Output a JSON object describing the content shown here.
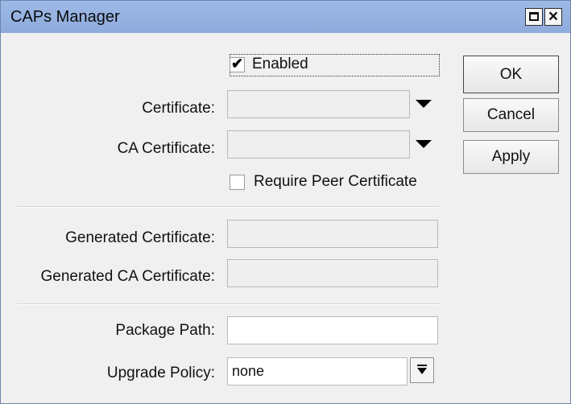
{
  "window": {
    "title": "CAPs Manager"
  },
  "enabled": {
    "label": "Enabled",
    "checked": true
  },
  "certificate": {
    "label": "Certificate:",
    "value": ""
  },
  "ca_certificate": {
    "label": "CA Certificate:",
    "value": ""
  },
  "require_peer": {
    "label": "Require Peer Certificate",
    "checked": false
  },
  "generated_certificate": {
    "label": "Generated Certificate:",
    "value": ""
  },
  "generated_ca_certificate": {
    "label": "Generated CA Certificate:",
    "value": ""
  },
  "package_path": {
    "label": "Package Path:",
    "value": ""
  },
  "upgrade_policy": {
    "label": "Upgrade Policy:",
    "value": "none"
  },
  "buttons": {
    "ok": "OK",
    "cancel": "Cancel",
    "apply": "Apply"
  },
  "icons": {
    "maximize": "maximize-icon",
    "close": "close-icon",
    "dropdown": "triangle-down-icon",
    "select": "arrow-down-bar-icon"
  }
}
